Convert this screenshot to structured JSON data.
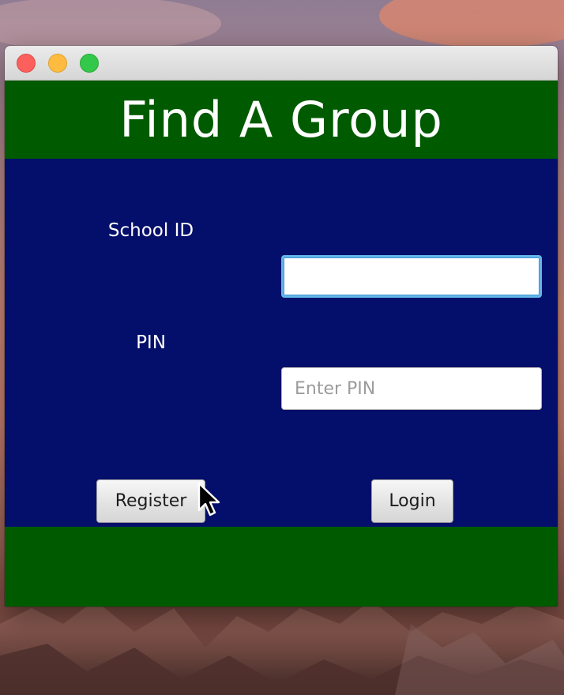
{
  "window": {
    "controls": [
      "close",
      "minimize",
      "zoom"
    ]
  },
  "header": {
    "title": "Find A Group"
  },
  "form": {
    "school_id_label": "School ID",
    "school_id_value": "",
    "pin_label": "PIN",
    "pin_placeholder": "Enter PIN",
    "register_label": "Register",
    "login_label": "Login"
  },
  "colors": {
    "header_green": "#005a00",
    "form_blue": "#030f6a",
    "focus_ring": "#62b6e8"
  },
  "icons": {
    "pointer": "arrow-cursor-icon"
  }
}
